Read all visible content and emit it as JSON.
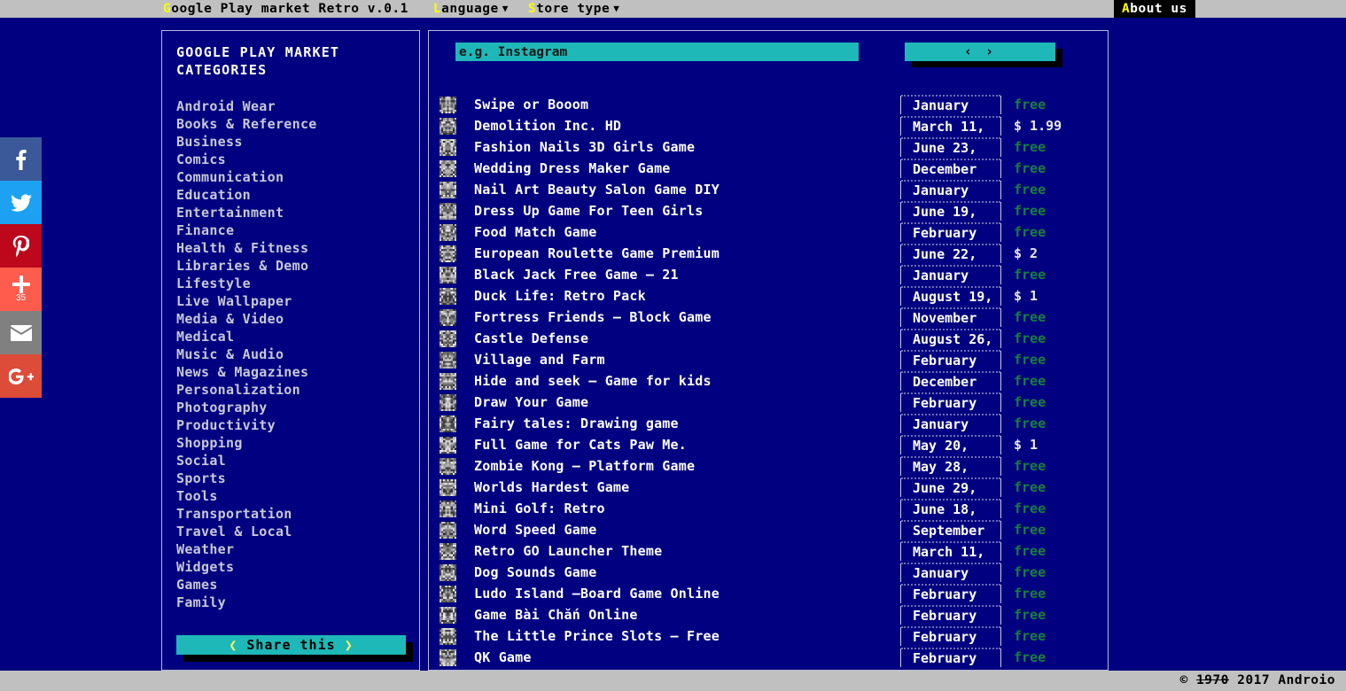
{
  "topbar": {
    "title": "Google Play market Retro v.0.1",
    "title_hotkey": "G",
    "menu": [
      {
        "label": "anguage",
        "hotkey": "L",
        "caret": "chevron-down-icon"
      },
      {
        "label": "tore type",
        "hotkey": "S",
        "caret": "chevron-down-icon"
      }
    ],
    "about": {
      "hotkey": "A",
      "label": "bout us"
    }
  },
  "social_rail": [
    {
      "name": "facebook",
      "glyph": "f",
      "color": "#3b5998",
      "count": ""
    },
    {
      "name": "twitter",
      "glyph": "twitter-bird",
      "color": "#1da1f2",
      "count": ""
    },
    {
      "name": "pinterest",
      "glyph": "P",
      "color": "#bd081c",
      "count": ""
    },
    {
      "name": "share-more",
      "glyph": "+",
      "color": "#ff5c4d",
      "count": "35"
    },
    {
      "name": "email",
      "glyph": "envelope",
      "color": "#808080",
      "count": ""
    },
    {
      "name": "google-plus",
      "glyph": "G+",
      "color": "#dd4b39",
      "count": ""
    }
  ],
  "sidebar": {
    "title_line1": "GOOGLE PLAY MARKET",
    "title_line2": "CATEGORIES",
    "categories": [
      "Android Wear",
      "Books & Reference",
      "Business",
      "Comics",
      "Communication",
      "Education",
      "Entertainment",
      "Finance",
      "Health & Fitness",
      "Libraries & Demo",
      "Lifestyle",
      "Live Wallpaper",
      "Media & Video",
      "Medical",
      "Music & Audio",
      "News & Magazines",
      "Personalization",
      "Photography",
      "Productivity",
      "Shopping",
      "Social",
      "Sports",
      "Tools",
      "Transportation",
      "Travel & Local",
      "Weather",
      "Widgets",
      "Games",
      "Family"
    ],
    "share_button": {
      "left_chevron": "❮",
      "label": "Share this",
      "right_chevron": "❯"
    }
  },
  "search": {
    "placeholder": "e.g. Instagram",
    "value": "",
    "button_label": "‹ ›"
  },
  "apps": [
    {
      "name": "Swipe or Booom",
      "date": "January",
      "price": "free",
      "free": true
    },
    {
      "name": "Demolition Inc. HD",
      "date": "March 11,",
      "price": "$ 1.99",
      "free": false
    },
    {
      "name": "Fashion Nails 3D Girls Game",
      "date": "June 23,",
      "price": "free",
      "free": true
    },
    {
      "name": "Wedding Dress Maker Game",
      "date": "December",
      "price": "free",
      "free": true
    },
    {
      "name": "Nail Art Beauty Salon Game DIY",
      "date": "January",
      "price": "free",
      "free": true
    },
    {
      "name": "Dress Up Game For Teen Girls",
      "date": "June 19,",
      "price": "free",
      "free": true
    },
    {
      "name": "Food Match Game",
      "date": "February",
      "price": "free",
      "free": true
    },
    {
      "name": "European Roulette Game Premium",
      "date": "June 22,",
      "price": "$ 2",
      "free": false
    },
    {
      "name": "Black Jack Free Game – 21",
      "date": "January",
      "price": "free",
      "free": true
    },
    {
      "name": "Duck Life: Retro Pack",
      "date": "August 19,",
      "price": "$ 1",
      "free": false
    },
    {
      "name": "Fortress Friends – Block Game",
      "date": "November",
      "price": "free",
      "free": true
    },
    {
      "name": "Castle Defense",
      "date": "August 26,",
      "price": "free",
      "free": true
    },
    {
      "name": "Village and Farm",
      "date": "February",
      "price": "free",
      "free": true
    },
    {
      "name": "Hide and seek – Game for kids",
      "date": "December",
      "price": "free",
      "free": true
    },
    {
      "name": "Draw Your Game",
      "date": "February",
      "price": "free",
      "free": true
    },
    {
      "name": "Fairy tales: Drawing game",
      "date": "January",
      "price": "free",
      "free": true
    },
    {
      "name": "Full Game for Cats Paw Me.",
      "date": "May 20,",
      "price": "$ 1",
      "free": false
    },
    {
      "name": "Zombie Kong – Platform Game",
      "date": "May 28,",
      "price": "free",
      "free": true
    },
    {
      "name": "Worlds Hardest Game",
      "date": "June 29,",
      "price": "free",
      "free": true
    },
    {
      "name": "Mini Golf: Retro",
      "date": "June 18,",
      "price": "free",
      "free": true
    },
    {
      "name": "Word Speed Game",
      "date": "September",
      "price": "free",
      "free": true
    },
    {
      "name": "Retro GO Launcher Theme",
      "date": "March 11,",
      "price": "free",
      "free": true
    },
    {
      "name": "Dog Sounds Game",
      "date": "January",
      "price": "free",
      "free": true
    },
    {
      "name": "Ludo Island –Board Game Online",
      "date": "February",
      "price": "free",
      "free": true
    },
    {
      "name": "Game Bài Chắn Online",
      "date": "February",
      "price": "free",
      "free": true
    },
    {
      "name": "The Little Prince Slots – Free",
      "date": "February",
      "price": "free",
      "free": true
    },
    {
      "name": "QK Game",
      "date": "February",
      "price": "free",
      "free": true
    }
  ],
  "footer": {
    "symbol": "©",
    "struck_year": "1970",
    "year": "2017",
    "owner": "Androio"
  },
  "colors": {
    "page_background": "#000080",
    "chrome_bar": "#c0c0c0",
    "accent_teal": "#1fb8b8",
    "hotkey_yellow": "#ffff00",
    "free_green": "#17803c",
    "panel_border": "#b8b8d8"
  }
}
